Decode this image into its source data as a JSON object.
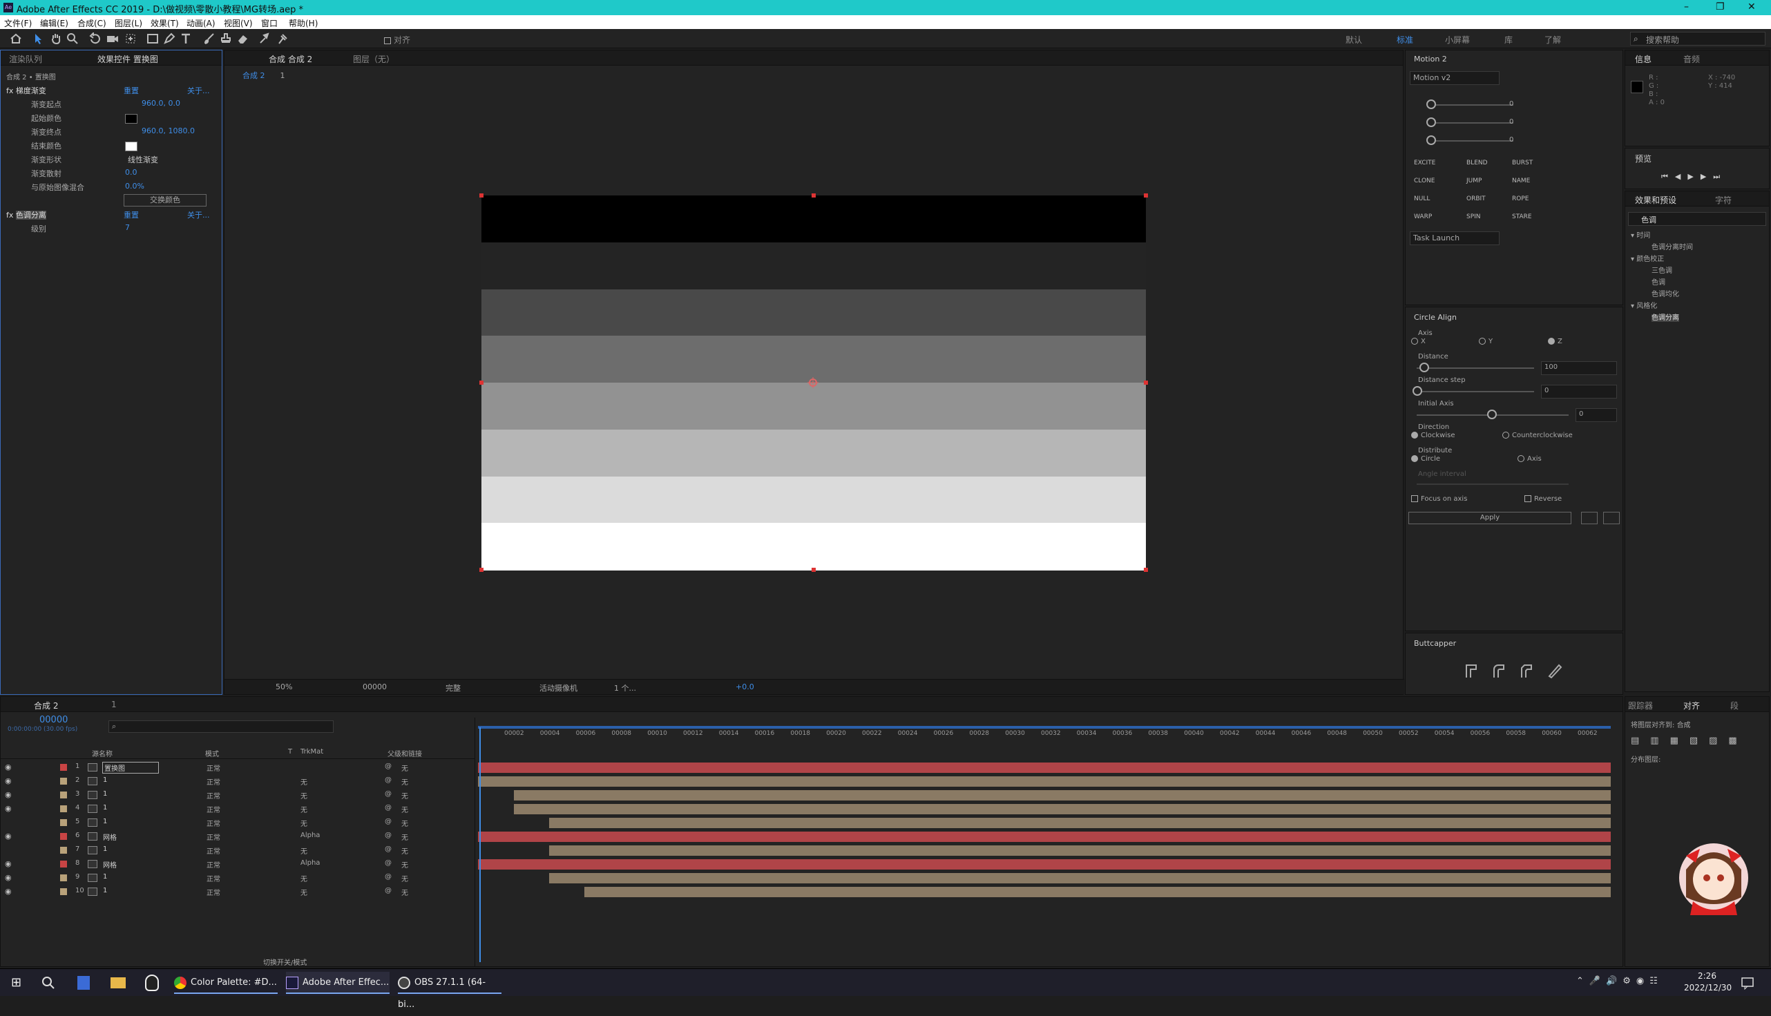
{
  "titlebar": {
    "title": "Adobe After Effects CC 2019 - D:\\做视频\\零散小教程\\MG转场.aep *",
    "app_icon": "Ae",
    "min": "–",
    "max": "❐",
    "close": "✕"
  },
  "menu": [
    "文件(F)",
    "编辑(E)",
    "合成(C)",
    "图层(L)",
    "效果(T)",
    "动画(A)",
    "视图(V)",
    "窗口",
    "帮助(H)"
  ],
  "toolbar": {
    "snap_label": "对齐",
    "workspaces": [
      "默认",
      "标准",
      "小屏幕",
      "库",
      "了解"
    ],
    "search_placeholder": "搜索帮助"
  },
  "effects_panel": {
    "tabs": [
      "渲染队列",
      "效果控件 置换图"
    ],
    "breadcrumb": "合成 2 • 置换图",
    "effects": [
      {
        "name": "梯度渐变",
        "reset": "重置",
        "about": "关于...",
        "props": [
          {
            "label": "渐变起点",
            "value": "960.0, 0.0"
          },
          {
            "label": "起始颜色",
            "value": ""
          },
          {
            "label": "渐变终点",
            "value": "960.0, 1080.0"
          },
          {
            "label": "结束颜色",
            "value": ""
          },
          {
            "label": "渐变形状",
            "value": "线性渐变"
          },
          {
            "label": "渐变散射",
            "value": "0.0"
          },
          {
            "label": "与原始图像混合",
            "value": "0.0%"
          }
        ],
        "swap_button": "交换颜色"
      },
      {
        "name": "色调分离",
        "reset": "重置",
        "about": "关于...",
        "props": [
          {
            "label": "级别",
            "value": "7"
          }
        ]
      }
    ]
  },
  "comp_panel": {
    "tabs": [
      "合成 合成 2",
      "图层（无）"
    ],
    "crumb": "合成 2",
    "crumb_child": "1",
    "zoom": "50%",
    "timecode": "00000",
    "quality": "完整",
    "camera": "活动摄像机",
    "views": "1 个...",
    "exposure": "+0.0"
  },
  "preview_bands": [
    "#000000",
    "#242424",
    "#494949",
    "#6d6d6d",
    "#929292",
    "#b6b6b6",
    "#dbdbdb",
    "#ffffff"
  ],
  "motion": {
    "title": "Motion 2",
    "preset": "Motion v2",
    "values": [
      "0",
      "0",
      "0"
    ],
    "buttons": [
      "EXCITE",
      "BLEND",
      "BURST",
      "CLONE",
      "JUMP",
      "NAME",
      "NULL",
      "ORBIT",
      "ROPE",
      "WARP",
      "SPIN",
      "STARE"
    ],
    "task": "Task Launch"
  },
  "circle_align": {
    "title": "Circle Align",
    "axis_label": "Axis",
    "axes": [
      "X",
      "Y",
      "Z"
    ],
    "distance_label": "Distance",
    "distance": "100",
    "distance_step_label": "Distance step",
    "distance_step": "0",
    "initial_axis_label": "Initial Axis",
    "initial_axis": "0",
    "direction_label": "Direction",
    "directions": [
      "Clockwise",
      "Counterclockwise"
    ],
    "distribute_label": "Distribute",
    "distributes": [
      "Circle",
      "Axis"
    ],
    "angle_label": "Angle interval",
    "focus": "Focus on axis",
    "reverse": "Reverse",
    "apply": "Apply"
  },
  "buttcapper": {
    "title": "Buttcapper"
  },
  "info": {
    "tabs": [
      "信息",
      "音频"
    ],
    "r": "R :",
    "g": "G :",
    "b": "B :",
    "a": "A : 0",
    "x": "X : -740",
    "y": "Y : 414"
  },
  "preview_panel": {
    "title": "预览"
  },
  "effects_presets": {
    "tabs": [
      "效果和预设",
      "字符"
    ],
    "search": "色调",
    "tree": [
      {
        "label": "时间",
        "children": [
          "色调分离时间"
        ]
      },
      {
        "label": "颜色校正",
        "children": [
          "三色调",
          "色调",
          "色调均化"
        ]
      },
      {
        "label": "风格化",
        "children": [
          "色调分离"
        ]
      }
    ]
  },
  "align_panel": {
    "tabs": [
      "跟踪器",
      "对齐",
      "段"
    ],
    "align_to_label": "将图层对齐到:",
    "align_to": "合成",
    "distribute": "分布图层:"
  },
  "timeline": {
    "tab": "合成 2",
    "tab2": "1",
    "timecode": "00000",
    "fps": "0:00:00:00 (30.00 fps)",
    "search_placeholder": "",
    "headers": [
      "源名称",
      "模式",
      "T",
      "TrkMat",
      "父级和链接"
    ],
    "ruler": [
      "00002",
      "00004",
      "00006",
      "00008",
      "00010",
      "00012",
      "00014",
      "00016",
      "00018",
      "00020",
      "00022",
      "00024",
      "00026",
      "00028",
      "00030",
      "00032",
      "00034",
      "00036",
      "00038",
      "00040",
      "00042",
      "00044",
      "00046",
      "00048",
      "00050",
      "00052",
      "00054",
      "00056",
      "00058",
      "00060",
      "00062"
    ],
    "layers": [
      {
        "num": "1",
        "name": "置换图",
        "mode": "正常",
        "trk": "",
        "parent": "无",
        "color": "#c94444",
        "visible": true
      },
      {
        "num": "2",
        "name": "1",
        "mode": "正常",
        "trk": "无",
        "parent": "无",
        "color": "#b9a27a",
        "visible": true
      },
      {
        "num": "3",
        "name": "1",
        "mode": "正常",
        "trk": "无",
        "parent": "无",
        "color": "#b9a27a",
        "visible": true
      },
      {
        "num": "4",
        "name": "1",
        "mode": "正常",
        "trk": "无",
        "parent": "无",
        "color": "#b9a27a",
        "visible": true
      },
      {
        "num": "5",
        "name": "1",
        "mode": "正常",
        "trk": "无",
        "parent": "无",
        "color": "#b9a27a",
        "visible": false
      },
      {
        "num": "6",
        "name": "网格",
        "mode": "正常",
        "trk": "Alpha",
        "parent": "无",
        "color": "#c94444",
        "visible": true
      },
      {
        "num": "7",
        "name": "1",
        "mode": "正常",
        "trk": "无",
        "parent": "无",
        "color": "#b9a27a",
        "visible": false
      },
      {
        "num": "8",
        "name": "网格",
        "mode": "正常",
        "trk": "Alpha",
        "parent": "无",
        "color": "#c94444",
        "visible": true
      },
      {
        "num": "9",
        "name": "1",
        "mode": "正常",
        "trk": "无",
        "parent": "无",
        "color": "#b9a27a",
        "visible": true
      },
      {
        "num": "10",
        "name": "1",
        "mode": "正常",
        "trk": "无",
        "parent": "无",
        "color": "#b9a27a",
        "visible": true
      }
    ],
    "bar_starts": [
      0,
      0,
      0.032,
      0.032,
      0.063,
      0,
      0.063,
      0,
      0.063,
      0.094
    ],
    "toggle_label": "切换开关/模式"
  },
  "taskbar": {
    "apps": [
      "Color Palette: #D...",
      "Adobe After Effec...",
      "OBS 27.1.1 (64-bi..."
    ],
    "time": "2:26",
    "date": "2022/12/30"
  }
}
